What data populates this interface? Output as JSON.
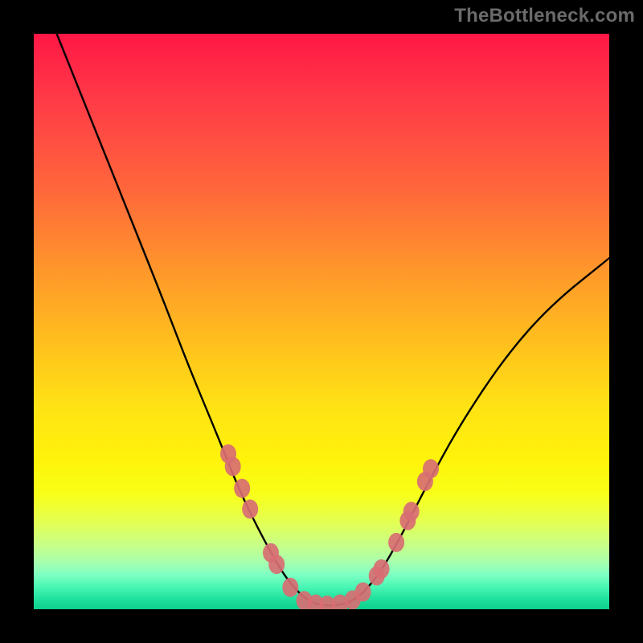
{
  "watermark": "TheBottleneck.com",
  "chart_data": {
    "type": "line",
    "title": "",
    "xlabel": "",
    "ylabel": "",
    "xlim": [
      0,
      100
    ],
    "ylim": [
      0,
      100
    ],
    "curve": {
      "name": "bottleneck-curve",
      "points": [
        [
          4,
          100
        ],
        [
          10,
          85
        ],
        [
          16,
          70
        ],
        [
          22,
          55
        ],
        [
          27,
          42
        ],
        [
          32,
          30
        ],
        [
          36,
          20
        ],
        [
          40,
          12
        ],
        [
          44,
          5
        ],
        [
          48,
          1
        ],
        [
          52,
          0.5
        ],
        [
          56,
          1.5
        ],
        [
          60,
          6
        ],
        [
          64,
          13
        ],
        [
          68,
          21
        ],
        [
          74,
          32
        ],
        [
          82,
          44
        ],
        [
          90,
          53
        ],
        [
          100,
          61
        ]
      ]
    },
    "markers": [
      [
        33.8,
        27.0
      ],
      [
        34.6,
        24.8
      ],
      [
        36.2,
        21.0
      ],
      [
        37.6,
        17.4
      ],
      [
        41.2,
        9.8
      ],
      [
        42.2,
        7.8
      ],
      [
        44.6,
        3.8
      ],
      [
        47.0,
        1.5
      ],
      [
        49.0,
        0.9
      ],
      [
        51.0,
        0.7
      ],
      [
        53.2,
        0.9
      ],
      [
        55.4,
        1.6
      ],
      [
        57.2,
        3.0
      ],
      [
        59.6,
        5.8
      ],
      [
        60.4,
        7.0
      ],
      [
        63.0,
        11.6
      ],
      [
        65.0,
        15.4
      ],
      [
        65.6,
        17.0
      ],
      [
        68.0,
        22.2
      ],
      [
        69.0,
        24.4
      ]
    ],
    "marker_color": "#d86e73",
    "curve_color": "#000000"
  }
}
